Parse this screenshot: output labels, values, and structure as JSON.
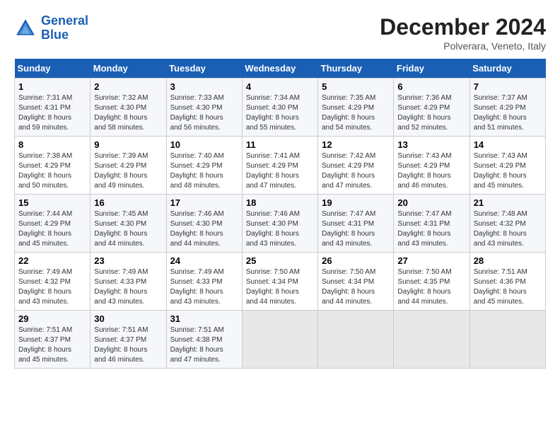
{
  "logo": {
    "line1": "General",
    "line2": "Blue"
  },
  "title": "December 2024",
  "subtitle": "Polverara, Veneto, Italy",
  "weekdays": [
    "Sunday",
    "Monday",
    "Tuesday",
    "Wednesday",
    "Thursday",
    "Friday",
    "Saturday"
  ],
  "weeks": [
    [
      {
        "day": 1,
        "info": "Sunrise: 7:31 AM\nSunset: 4:31 PM\nDaylight: 8 hours\nand 59 minutes."
      },
      {
        "day": 2,
        "info": "Sunrise: 7:32 AM\nSunset: 4:30 PM\nDaylight: 8 hours\nand 58 minutes."
      },
      {
        "day": 3,
        "info": "Sunrise: 7:33 AM\nSunset: 4:30 PM\nDaylight: 8 hours\nand 56 minutes."
      },
      {
        "day": 4,
        "info": "Sunrise: 7:34 AM\nSunset: 4:30 PM\nDaylight: 8 hours\nand 55 minutes."
      },
      {
        "day": 5,
        "info": "Sunrise: 7:35 AM\nSunset: 4:29 PM\nDaylight: 8 hours\nand 54 minutes."
      },
      {
        "day": 6,
        "info": "Sunrise: 7:36 AM\nSunset: 4:29 PM\nDaylight: 8 hours\nand 52 minutes."
      },
      {
        "day": 7,
        "info": "Sunrise: 7:37 AM\nSunset: 4:29 PM\nDaylight: 8 hours\nand 51 minutes."
      }
    ],
    [
      {
        "day": 8,
        "info": "Sunrise: 7:38 AM\nSunset: 4:29 PM\nDaylight: 8 hours\nand 50 minutes."
      },
      {
        "day": 9,
        "info": "Sunrise: 7:39 AM\nSunset: 4:29 PM\nDaylight: 8 hours\nand 49 minutes."
      },
      {
        "day": 10,
        "info": "Sunrise: 7:40 AM\nSunset: 4:29 PM\nDaylight: 8 hours\nand 48 minutes."
      },
      {
        "day": 11,
        "info": "Sunrise: 7:41 AM\nSunset: 4:29 PM\nDaylight: 8 hours\nand 47 minutes."
      },
      {
        "day": 12,
        "info": "Sunrise: 7:42 AM\nSunset: 4:29 PM\nDaylight: 8 hours\nand 47 minutes."
      },
      {
        "day": 13,
        "info": "Sunrise: 7:43 AM\nSunset: 4:29 PM\nDaylight: 8 hours\nand 46 minutes."
      },
      {
        "day": 14,
        "info": "Sunrise: 7:43 AM\nSunset: 4:29 PM\nDaylight: 8 hours\nand 45 minutes."
      }
    ],
    [
      {
        "day": 15,
        "info": "Sunrise: 7:44 AM\nSunset: 4:29 PM\nDaylight: 8 hours\nand 45 minutes."
      },
      {
        "day": 16,
        "info": "Sunrise: 7:45 AM\nSunset: 4:30 PM\nDaylight: 8 hours\nand 44 minutes."
      },
      {
        "day": 17,
        "info": "Sunrise: 7:46 AM\nSunset: 4:30 PM\nDaylight: 8 hours\nand 44 minutes."
      },
      {
        "day": 18,
        "info": "Sunrise: 7:46 AM\nSunset: 4:30 PM\nDaylight: 8 hours\nand 43 minutes."
      },
      {
        "day": 19,
        "info": "Sunrise: 7:47 AM\nSunset: 4:31 PM\nDaylight: 8 hours\nand 43 minutes."
      },
      {
        "day": 20,
        "info": "Sunrise: 7:47 AM\nSunset: 4:31 PM\nDaylight: 8 hours\nand 43 minutes."
      },
      {
        "day": 21,
        "info": "Sunrise: 7:48 AM\nSunset: 4:32 PM\nDaylight: 8 hours\nand 43 minutes."
      }
    ],
    [
      {
        "day": 22,
        "info": "Sunrise: 7:49 AM\nSunset: 4:32 PM\nDaylight: 8 hours\nand 43 minutes."
      },
      {
        "day": 23,
        "info": "Sunrise: 7:49 AM\nSunset: 4:33 PM\nDaylight: 8 hours\nand 43 minutes."
      },
      {
        "day": 24,
        "info": "Sunrise: 7:49 AM\nSunset: 4:33 PM\nDaylight: 8 hours\nand 43 minutes."
      },
      {
        "day": 25,
        "info": "Sunrise: 7:50 AM\nSunset: 4:34 PM\nDaylight: 8 hours\nand 44 minutes."
      },
      {
        "day": 26,
        "info": "Sunrise: 7:50 AM\nSunset: 4:34 PM\nDaylight: 8 hours\nand 44 minutes."
      },
      {
        "day": 27,
        "info": "Sunrise: 7:50 AM\nSunset: 4:35 PM\nDaylight: 8 hours\nand 44 minutes."
      },
      {
        "day": 28,
        "info": "Sunrise: 7:51 AM\nSunset: 4:36 PM\nDaylight: 8 hours\nand 45 minutes."
      }
    ],
    [
      {
        "day": 29,
        "info": "Sunrise: 7:51 AM\nSunset: 4:37 PM\nDaylight: 8 hours\nand 45 minutes."
      },
      {
        "day": 30,
        "info": "Sunrise: 7:51 AM\nSunset: 4:37 PM\nDaylight: 8 hours\nand 46 minutes."
      },
      {
        "day": 31,
        "info": "Sunrise: 7:51 AM\nSunset: 4:38 PM\nDaylight: 8 hours\nand 47 minutes."
      },
      null,
      null,
      null,
      null
    ]
  ]
}
